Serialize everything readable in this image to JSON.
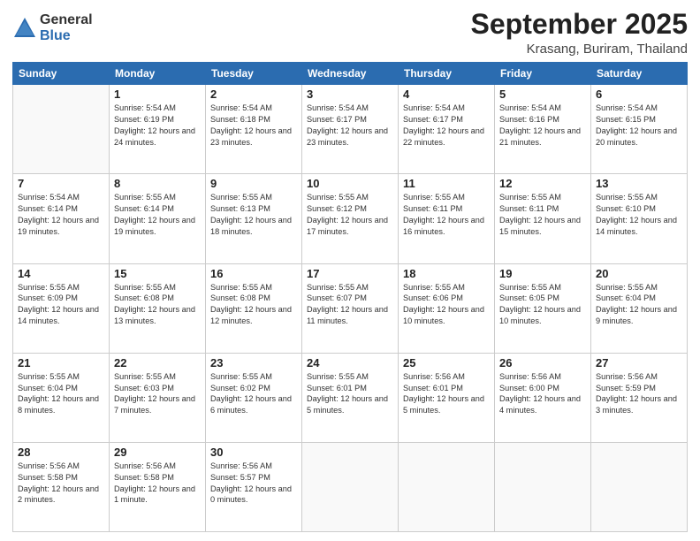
{
  "logo": {
    "general": "General",
    "blue": "Blue"
  },
  "title": "September 2025",
  "location": "Krasang, Buriram, Thailand",
  "days_of_week": [
    "Sunday",
    "Monday",
    "Tuesday",
    "Wednesday",
    "Thursday",
    "Friday",
    "Saturday"
  ],
  "weeks": [
    [
      {
        "day": "",
        "info": ""
      },
      {
        "day": "1",
        "info": "Sunrise: 5:54 AM\nSunset: 6:19 PM\nDaylight: 12 hours\nand 24 minutes."
      },
      {
        "day": "2",
        "info": "Sunrise: 5:54 AM\nSunset: 6:18 PM\nDaylight: 12 hours\nand 23 minutes."
      },
      {
        "day": "3",
        "info": "Sunrise: 5:54 AM\nSunset: 6:17 PM\nDaylight: 12 hours\nand 23 minutes."
      },
      {
        "day": "4",
        "info": "Sunrise: 5:54 AM\nSunset: 6:17 PM\nDaylight: 12 hours\nand 22 minutes."
      },
      {
        "day": "5",
        "info": "Sunrise: 5:54 AM\nSunset: 6:16 PM\nDaylight: 12 hours\nand 21 minutes."
      },
      {
        "day": "6",
        "info": "Sunrise: 5:54 AM\nSunset: 6:15 PM\nDaylight: 12 hours\nand 20 minutes."
      }
    ],
    [
      {
        "day": "7",
        "info": "Sunrise: 5:54 AM\nSunset: 6:14 PM\nDaylight: 12 hours\nand 19 minutes."
      },
      {
        "day": "8",
        "info": "Sunrise: 5:55 AM\nSunset: 6:14 PM\nDaylight: 12 hours\nand 19 minutes."
      },
      {
        "day": "9",
        "info": "Sunrise: 5:55 AM\nSunset: 6:13 PM\nDaylight: 12 hours\nand 18 minutes."
      },
      {
        "day": "10",
        "info": "Sunrise: 5:55 AM\nSunset: 6:12 PM\nDaylight: 12 hours\nand 17 minutes."
      },
      {
        "day": "11",
        "info": "Sunrise: 5:55 AM\nSunset: 6:11 PM\nDaylight: 12 hours\nand 16 minutes."
      },
      {
        "day": "12",
        "info": "Sunrise: 5:55 AM\nSunset: 6:11 PM\nDaylight: 12 hours\nand 15 minutes."
      },
      {
        "day": "13",
        "info": "Sunrise: 5:55 AM\nSunset: 6:10 PM\nDaylight: 12 hours\nand 14 minutes."
      }
    ],
    [
      {
        "day": "14",
        "info": "Sunrise: 5:55 AM\nSunset: 6:09 PM\nDaylight: 12 hours\nand 14 minutes."
      },
      {
        "day": "15",
        "info": "Sunrise: 5:55 AM\nSunset: 6:08 PM\nDaylight: 12 hours\nand 13 minutes."
      },
      {
        "day": "16",
        "info": "Sunrise: 5:55 AM\nSunset: 6:08 PM\nDaylight: 12 hours\nand 12 minutes."
      },
      {
        "day": "17",
        "info": "Sunrise: 5:55 AM\nSunset: 6:07 PM\nDaylight: 12 hours\nand 11 minutes."
      },
      {
        "day": "18",
        "info": "Sunrise: 5:55 AM\nSunset: 6:06 PM\nDaylight: 12 hours\nand 10 minutes."
      },
      {
        "day": "19",
        "info": "Sunrise: 5:55 AM\nSunset: 6:05 PM\nDaylight: 12 hours\nand 10 minutes."
      },
      {
        "day": "20",
        "info": "Sunrise: 5:55 AM\nSunset: 6:04 PM\nDaylight: 12 hours\nand 9 minutes."
      }
    ],
    [
      {
        "day": "21",
        "info": "Sunrise: 5:55 AM\nSunset: 6:04 PM\nDaylight: 12 hours\nand 8 minutes."
      },
      {
        "day": "22",
        "info": "Sunrise: 5:55 AM\nSunset: 6:03 PM\nDaylight: 12 hours\nand 7 minutes."
      },
      {
        "day": "23",
        "info": "Sunrise: 5:55 AM\nSunset: 6:02 PM\nDaylight: 12 hours\nand 6 minutes."
      },
      {
        "day": "24",
        "info": "Sunrise: 5:55 AM\nSunset: 6:01 PM\nDaylight: 12 hours\nand 5 minutes."
      },
      {
        "day": "25",
        "info": "Sunrise: 5:56 AM\nSunset: 6:01 PM\nDaylight: 12 hours\nand 5 minutes."
      },
      {
        "day": "26",
        "info": "Sunrise: 5:56 AM\nSunset: 6:00 PM\nDaylight: 12 hours\nand 4 minutes."
      },
      {
        "day": "27",
        "info": "Sunrise: 5:56 AM\nSunset: 5:59 PM\nDaylight: 12 hours\nand 3 minutes."
      }
    ],
    [
      {
        "day": "28",
        "info": "Sunrise: 5:56 AM\nSunset: 5:58 PM\nDaylight: 12 hours\nand 2 minutes."
      },
      {
        "day": "29",
        "info": "Sunrise: 5:56 AM\nSunset: 5:58 PM\nDaylight: 12 hours\nand 1 minute."
      },
      {
        "day": "30",
        "info": "Sunrise: 5:56 AM\nSunset: 5:57 PM\nDaylight: 12 hours\nand 0 minutes."
      },
      {
        "day": "",
        "info": ""
      },
      {
        "day": "",
        "info": ""
      },
      {
        "day": "",
        "info": ""
      },
      {
        "day": "",
        "info": ""
      }
    ]
  ]
}
